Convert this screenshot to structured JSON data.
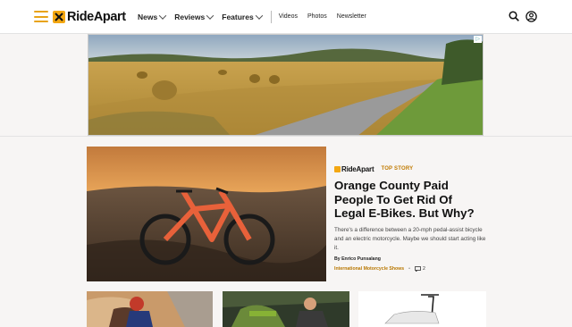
{
  "header": {
    "logo_text": "RideApart",
    "nav": [
      {
        "label": "News",
        "has_dropdown": true
      },
      {
        "label": "Reviews",
        "has_dropdown": true
      },
      {
        "label": "Features",
        "has_dropdown": true
      }
    ],
    "links": [
      "Videos",
      "Photos",
      "Newsletter"
    ],
    "icons": [
      "menu-icon",
      "search-icon",
      "account-icon"
    ]
  },
  "ad": {
    "badge": "▷"
  },
  "top_story": {
    "brand": "RideApart",
    "tag": "TOP STORY",
    "headline": "Orange County Paid People To Get Rid Of Legal E-Bikes. But Why?",
    "dek": "There's a difference between a 20-mph pedal-assist bicycle and an electric motorcycle. Maybe we should start acting like it.",
    "byline_prefix": "By",
    "author": "Enrico Punsalang",
    "category": "International Motorcycle Shows",
    "separator": "•",
    "comment_count": "2"
  },
  "colors": {
    "accent": "#f3a712",
    "category": "#b87700"
  }
}
